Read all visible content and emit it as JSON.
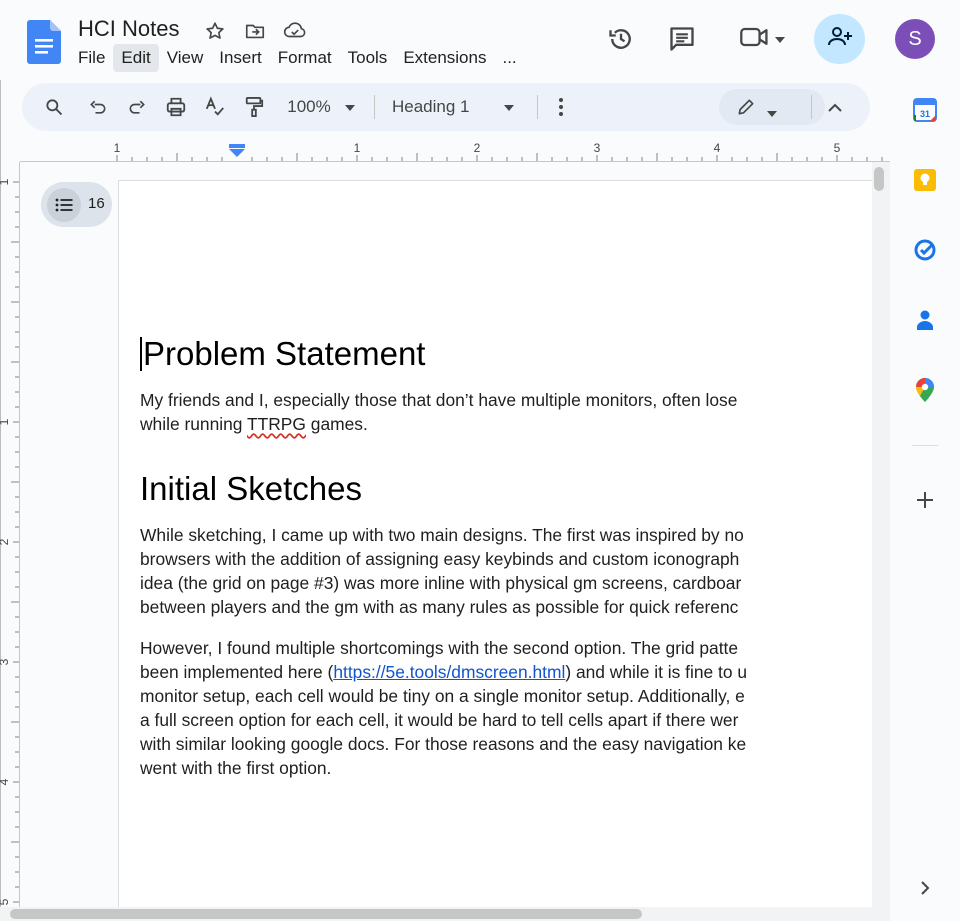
{
  "doc": {
    "title": "HCI Notes"
  },
  "menu": [
    "File",
    "Edit",
    "View",
    "Insert",
    "Format",
    "Tools",
    "Extensions",
    "..."
  ],
  "header": {
    "avatar_letter": "S",
    "share_color": "#c2e7ff",
    "avatar_color": "#7b4fb7"
  },
  "toolbar": {
    "zoom": "100%",
    "style": "Heading 1"
  },
  "ruler": {
    "horizontal_labels": [
      "1",
      "1",
      "2",
      "3",
      "4",
      "5"
    ],
    "vertical_labels": [
      "1",
      "1",
      "2",
      "3",
      "4",
      "5"
    ]
  },
  "outline": {
    "count": "16"
  },
  "content": {
    "h1": "Problem Statement",
    "p1_line1": "My friends and I, especially those that don’t have multiple monitors, often lose",
    "p1_line2_a": "while running ",
    "p1_line2_spell": "TTRPG",
    "p1_line2_b": " games.",
    "h2": "Initial Sketches",
    "p2_line1": "While sketching, I came up with two main designs. The first was inspired by no",
    "p2_line2": "browsers with the addition of assigning easy keybinds and custom iconograph",
    "p2_line3": "idea (the grid on page #3) was more inline with physical gm screens, cardboar",
    "p2_line4": "between players and the gm with as many rules as possible for quick referenc",
    "p3_line1": "However, I found multiple shortcomings with the second option. The grid patte",
    "p3_line2_a": "been implemented here (",
    "p3_line2_link": "https://5e.tools/dmscreen.html",
    "p3_line2_b": ") and while it is fine to u",
    "p3_line3": "monitor setup, each cell would be tiny on a single monitor setup. Additionally, e",
    "p3_line4": "a full screen option for each cell, it would be hard to tell cells apart if there wer",
    "p3_line5": "with similar looking google docs. For those reasons and the easy navigation ke",
    "p3_line6": "went with the first option."
  },
  "side_icons": [
    "calendar-icon",
    "keep-icon",
    "tasks-icon",
    "contacts-icon",
    "maps-icon",
    "add-icon"
  ]
}
